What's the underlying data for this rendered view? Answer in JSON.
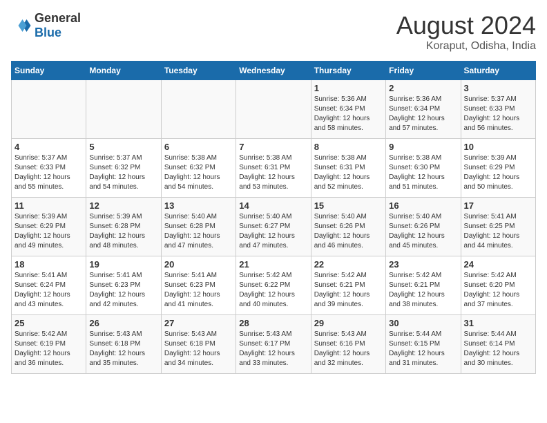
{
  "header": {
    "logo_general": "General",
    "logo_blue": "Blue",
    "month_title": "August 2024",
    "location": "Koraput, Odisha, India"
  },
  "days_of_week": [
    "Sunday",
    "Monday",
    "Tuesday",
    "Wednesday",
    "Thursday",
    "Friday",
    "Saturday"
  ],
  "weeks": [
    [
      {
        "day": "",
        "info": ""
      },
      {
        "day": "",
        "info": ""
      },
      {
        "day": "",
        "info": ""
      },
      {
        "day": "",
        "info": ""
      },
      {
        "day": "1",
        "info": "Sunrise: 5:36 AM\nSunset: 6:34 PM\nDaylight: 12 hours\nand 58 minutes."
      },
      {
        "day": "2",
        "info": "Sunrise: 5:36 AM\nSunset: 6:34 PM\nDaylight: 12 hours\nand 57 minutes."
      },
      {
        "day": "3",
        "info": "Sunrise: 5:37 AM\nSunset: 6:33 PM\nDaylight: 12 hours\nand 56 minutes."
      }
    ],
    [
      {
        "day": "4",
        "info": "Sunrise: 5:37 AM\nSunset: 6:33 PM\nDaylight: 12 hours\nand 55 minutes."
      },
      {
        "day": "5",
        "info": "Sunrise: 5:37 AM\nSunset: 6:32 PM\nDaylight: 12 hours\nand 54 minutes."
      },
      {
        "day": "6",
        "info": "Sunrise: 5:38 AM\nSunset: 6:32 PM\nDaylight: 12 hours\nand 54 minutes."
      },
      {
        "day": "7",
        "info": "Sunrise: 5:38 AM\nSunset: 6:31 PM\nDaylight: 12 hours\nand 53 minutes."
      },
      {
        "day": "8",
        "info": "Sunrise: 5:38 AM\nSunset: 6:31 PM\nDaylight: 12 hours\nand 52 minutes."
      },
      {
        "day": "9",
        "info": "Sunrise: 5:38 AM\nSunset: 6:30 PM\nDaylight: 12 hours\nand 51 minutes."
      },
      {
        "day": "10",
        "info": "Sunrise: 5:39 AM\nSunset: 6:29 PM\nDaylight: 12 hours\nand 50 minutes."
      }
    ],
    [
      {
        "day": "11",
        "info": "Sunrise: 5:39 AM\nSunset: 6:29 PM\nDaylight: 12 hours\nand 49 minutes."
      },
      {
        "day": "12",
        "info": "Sunrise: 5:39 AM\nSunset: 6:28 PM\nDaylight: 12 hours\nand 48 minutes."
      },
      {
        "day": "13",
        "info": "Sunrise: 5:40 AM\nSunset: 6:28 PM\nDaylight: 12 hours\nand 47 minutes."
      },
      {
        "day": "14",
        "info": "Sunrise: 5:40 AM\nSunset: 6:27 PM\nDaylight: 12 hours\nand 47 minutes."
      },
      {
        "day": "15",
        "info": "Sunrise: 5:40 AM\nSunset: 6:26 PM\nDaylight: 12 hours\nand 46 minutes."
      },
      {
        "day": "16",
        "info": "Sunrise: 5:40 AM\nSunset: 6:26 PM\nDaylight: 12 hours\nand 45 minutes."
      },
      {
        "day": "17",
        "info": "Sunrise: 5:41 AM\nSunset: 6:25 PM\nDaylight: 12 hours\nand 44 minutes."
      }
    ],
    [
      {
        "day": "18",
        "info": "Sunrise: 5:41 AM\nSunset: 6:24 PM\nDaylight: 12 hours\nand 43 minutes."
      },
      {
        "day": "19",
        "info": "Sunrise: 5:41 AM\nSunset: 6:23 PM\nDaylight: 12 hours\nand 42 minutes."
      },
      {
        "day": "20",
        "info": "Sunrise: 5:41 AM\nSunset: 6:23 PM\nDaylight: 12 hours\nand 41 minutes."
      },
      {
        "day": "21",
        "info": "Sunrise: 5:42 AM\nSunset: 6:22 PM\nDaylight: 12 hours\nand 40 minutes."
      },
      {
        "day": "22",
        "info": "Sunrise: 5:42 AM\nSunset: 6:21 PM\nDaylight: 12 hours\nand 39 minutes."
      },
      {
        "day": "23",
        "info": "Sunrise: 5:42 AM\nSunset: 6:21 PM\nDaylight: 12 hours\nand 38 minutes."
      },
      {
        "day": "24",
        "info": "Sunrise: 5:42 AM\nSunset: 6:20 PM\nDaylight: 12 hours\nand 37 minutes."
      }
    ],
    [
      {
        "day": "25",
        "info": "Sunrise: 5:42 AM\nSunset: 6:19 PM\nDaylight: 12 hours\nand 36 minutes."
      },
      {
        "day": "26",
        "info": "Sunrise: 5:43 AM\nSunset: 6:18 PM\nDaylight: 12 hours\nand 35 minutes."
      },
      {
        "day": "27",
        "info": "Sunrise: 5:43 AM\nSunset: 6:18 PM\nDaylight: 12 hours\nand 34 minutes."
      },
      {
        "day": "28",
        "info": "Sunrise: 5:43 AM\nSunset: 6:17 PM\nDaylight: 12 hours\nand 33 minutes."
      },
      {
        "day": "29",
        "info": "Sunrise: 5:43 AM\nSunset: 6:16 PM\nDaylight: 12 hours\nand 32 minutes."
      },
      {
        "day": "30",
        "info": "Sunrise: 5:44 AM\nSunset: 6:15 PM\nDaylight: 12 hours\nand 31 minutes."
      },
      {
        "day": "31",
        "info": "Sunrise: 5:44 AM\nSunset: 6:14 PM\nDaylight: 12 hours\nand 30 minutes."
      }
    ]
  ]
}
